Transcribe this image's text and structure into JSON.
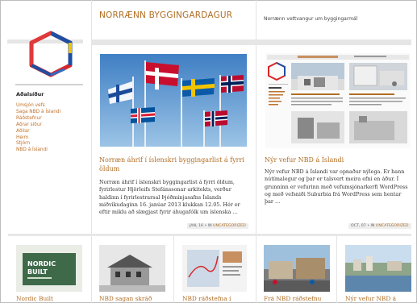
{
  "header": {
    "site_title": "NORRÆNN BYGGINGARDAGUR",
    "tagline": "Norrænn vettvangur um byggingarmál"
  },
  "sidebar": {
    "heading": "Aðalsíður",
    "items": [
      {
        "label": "Umsjón vefs"
      },
      {
        "label": "Saga NBD á Íslandi"
      },
      {
        "label": "Ráðstefnur"
      },
      {
        "label": "Aðrar síður"
      },
      {
        "label": "Aðilar"
      },
      {
        "label": "Heim"
      },
      {
        "label": "Stjórn"
      },
      {
        "label": "NBD á Íslandi"
      }
    ]
  },
  "posts": [
    {
      "title": "Norræn áhrif í íslenskri byggingarlist á fyrri öldum",
      "excerpt": "Norræn áhrif í íslenskri byggingarlist á fyrri öldum, fyrirlestur Hjörleifs Stefánssonar arkitekts, verður haldinn í fyrirlestrarsal Þjóðminjasafns Íslands miðvikudaginn 16. janúar 2013 klukkan 12.05.   Hér er eftir miklu að slægjast fyrir áhugafólk um íslenska …",
      "date": "JAN, 16",
      "category": "UNCATEGORIZED"
    },
    {
      "title": "Nýr vefur NBD á Íslandi",
      "excerpt": "Nýr vefur NBD á Íslandi var opnaður nýlega. Er hann nútímalegur og þar er talsvert meira efni en áður. Í grunninn er vefurinn með vefumsjónarkerfi WordPress og með vefsniði Suburbia frá WordPress sem hentar þar …",
      "date": "OCT, 07",
      "category": "UNCATEGORIZED"
    }
  ],
  "bottom_cards": [
    {
      "title": "Nordic Built",
      "image_text": "NORDIC\nBUILT"
    },
    {
      "title": "NBD sagan skráð"
    },
    {
      "title": "NBD ráðstefna í"
    },
    {
      "title": "Frá NBD ráðstefnu"
    },
    {
      "title": "Nýr vefur NBD á"
    }
  ],
  "meta_in": "IN",
  "colors": {
    "accent": "#b06d23",
    "sidebar_link": "#c0712b",
    "rule": "#e6e6e6"
  }
}
